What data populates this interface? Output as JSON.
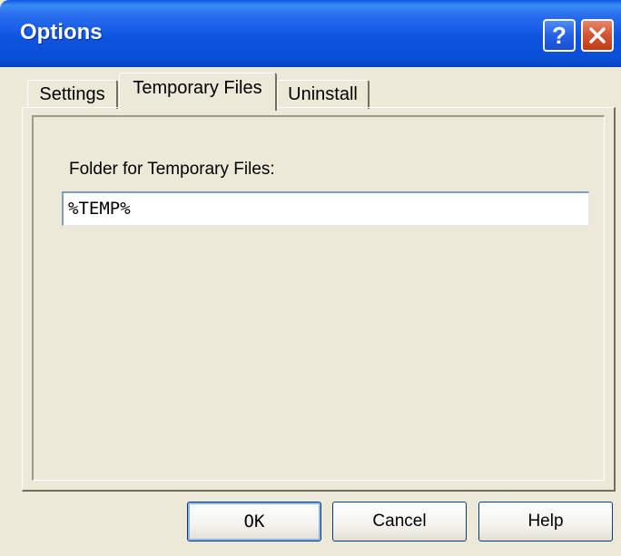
{
  "window": {
    "title": "Options",
    "help_button": "?",
    "close_button": "✕"
  },
  "tabs": [
    {
      "label": "Settings",
      "selected": false
    },
    {
      "label": "Temporary Files",
      "selected": true
    },
    {
      "label": "Uninstall",
      "selected": false
    }
  ],
  "temp_files": {
    "folder_label": "Folder for Temporary Files:",
    "folder_value": "%TEMP%"
  },
  "buttons": {
    "ok": "OK",
    "cancel": "Cancel",
    "help": "Help"
  },
  "colors": {
    "titlebar": "#0b4fd8",
    "dialog_face": "#ece9d8",
    "close_button": "#d4532f"
  }
}
